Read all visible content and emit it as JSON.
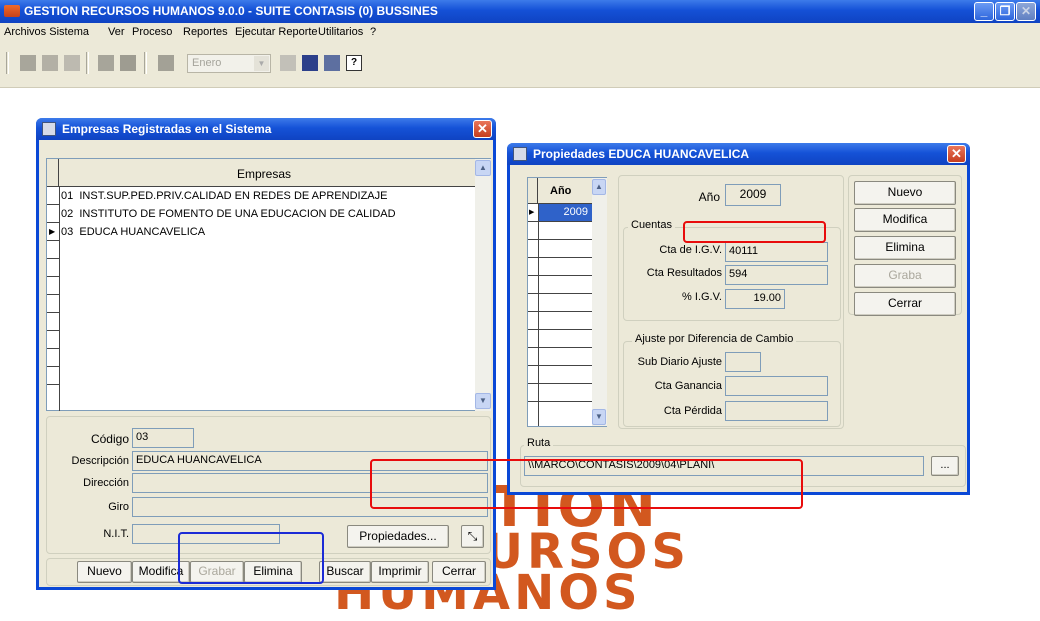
{
  "window": {
    "title": "GESTION RECURSOS HUMANOS 9.0.0 - SUITE CONTASIS (0) BUSSINES"
  },
  "menu": [
    "Archivos Sistema",
    "Ver",
    "Proceso",
    "Reportes",
    "Ejecutar Reporte",
    "Utilitarios",
    "?"
  ],
  "toolbar": {
    "month_placeholder": "Enero"
  },
  "background_logo": {
    "line1": "STION",
    "line2": "URSOS",
    "line3": "HUMANOS"
  },
  "empresas_dialog": {
    "title": "Empresas Registradas en el Sistema",
    "column_header": "Empresas",
    "rows": [
      {
        "code": "01",
        "name": "INST.SUP.PED.PRIV.CALIDAD EN REDES DE APRENDIZAJE"
      },
      {
        "code": "02",
        "name": "INSTITUTO DE FOMENTO DE UNA EDUCACION DE CALIDAD"
      },
      {
        "code": "03",
        "name": "EDUCA HUANCAVELICA"
      }
    ],
    "fields": {
      "codigo_label": "Código",
      "codigo_value": "03",
      "descripcion_label": "Descripción",
      "descripcion_value": "EDUCA HUANCAVELICA",
      "direccion_label": "Dirección",
      "direccion_value": "",
      "giro_label": "Giro",
      "giro_value": "",
      "nit_label": "N.I.T.",
      "nit_value": ""
    },
    "propiedades_button": "Propiedades...",
    "buttons": [
      "Nuevo",
      "Modifica",
      "Grabar",
      "Elimina",
      "Buscar",
      "Imprimir",
      "Cerrar"
    ]
  },
  "propiedades_dialog": {
    "title": "Propiedades EDUCA HUANCAVELICA",
    "year_column": "Año",
    "years": [
      "2009"
    ],
    "anio_label": "Año",
    "anio_value": "2009",
    "cuentas_group": "Cuentas",
    "cta_igv_label": "Cta de I.G.V.",
    "cta_igv_value": "40111",
    "cta_resultados_label": "Cta Resultados",
    "cta_resultados_value": "594",
    "pct_igv_label": "% I.G.V.",
    "pct_igv_value": "19.00",
    "ajuste_group": "Ajuste por Diferencia de Cambio",
    "sub_diario_label": "Sub Diario Ajuste",
    "sub_diario_value": "",
    "cta_ganancia_label": "Cta Ganancia",
    "cta_ganancia_value": "",
    "cta_perdida_label": "Cta Pérdida",
    "cta_perdida_value": "",
    "ruta_group": "Ruta",
    "ruta_value": "\\\\MARCO\\CONTASIS\\2009\\04\\PLANI\\",
    "browse_button": "...",
    "buttons": [
      "Nuevo",
      "Modifica",
      "Elimina",
      "Graba",
      "Cerrar"
    ]
  },
  "colors": {
    "highlight_red": "#e80c0c",
    "highlight_blue": "#1b2bd6",
    "title_blue": "#0a48d6"
  }
}
